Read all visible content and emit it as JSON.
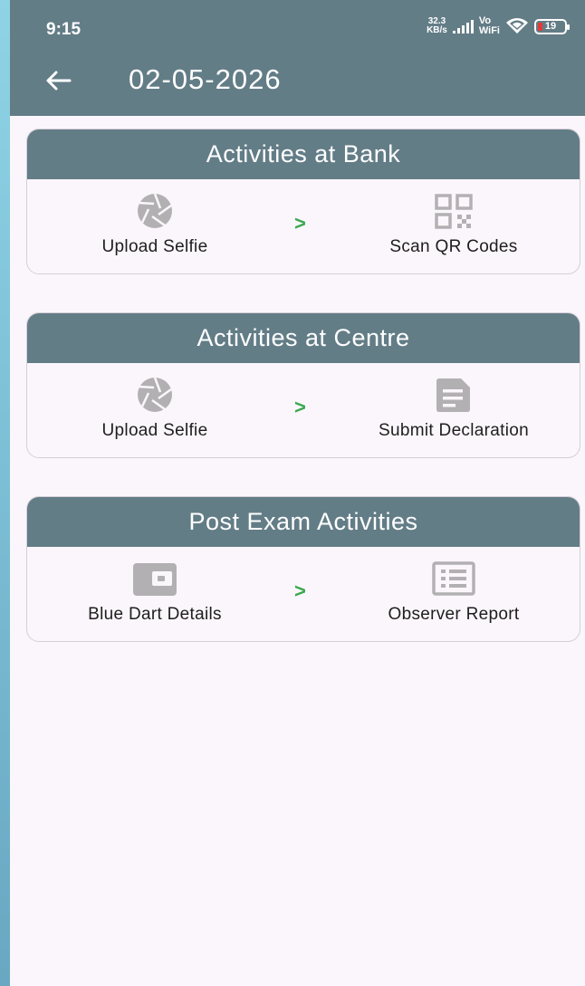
{
  "status_bar": {
    "time": "9:15",
    "net_speed_value": "32.3",
    "net_speed_unit": "KB/s",
    "vo_label": "Vo",
    "wifi_label": "WiFi",
    "battery_level": "19"
  },
  "header": {
    "title": "02-05-2026"
  },
  "sections": [
    {
      "title": "Activities at Bank",
      "left": {
        "label": "Upload Selfie",
        "icon": "camera-shutter-icon"
      },
      "right": {
        "label": "Scan QR Codes",
        "icon": "qr-code-icon"
      }
    },
    {
      "title": "Activities at Centre",
      "left": {
        "label": "Upload Selfie",
        "icon": "camera-shutter-icon"
      },
      "right": {
        "label": "Submit Declaration",
        "icon": "document-icon"
      }
    },
    {
      "title": "Post Exam Activities",
      "left": {
        "label": "Blue Dart Details",
        "icon": "wallet-icon"
      },
      "right": {
        "label": "Observer Report",
        "icon": "list-report-icon"
      }
    }
  ],
  "arrow_glyph": ">",
  "colors": {
    "header": "#637d87",
    "background": "#fbf6fb",
    "icon_gray": "#b3b0b4",
    "arrow_green": "#3aa84d"
  }
}
